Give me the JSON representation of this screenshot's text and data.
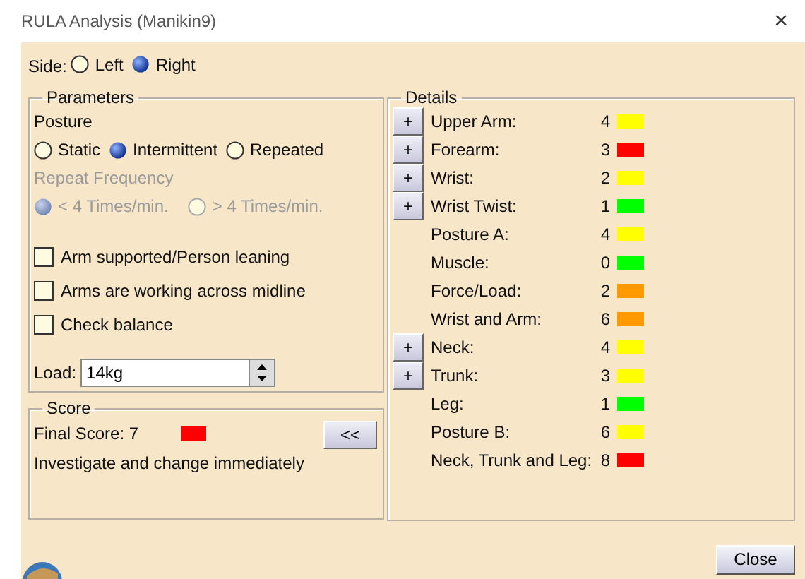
{
  "window": {
    "title": "RULA Analysis (Manikin9)",
    "close": "×"
  },
  "side": {
    "label": "Side:",
    "options": [
      {
        "label": "Left",
        "selected": false
      },
      {
        "label": "Right",
        "selected": true
      }
    ]
  },
  "parameters": {
    "title": "Parameters",
    "posture_label": "Posture",
    "posture_options": [
      {
        "label": "Static",
        "selected": false
      },
      {
        "label": "Intermittent",
        "selected": true
      },
      {
        "label": "Repeated",
        "selected": false
      }
    ],
    "repeat_frequency": {
      "label": "Repeat Frequency",
      "disabled": true,
      "options": [
        {
          "label": "< 4 Times/min.",
          "selected": true
        },
        {
          "label": "> 4 Times/min.",
          "selected": false
        }
      ]
    },
    "checkboxes": [
      {
        "label": "Arm supported/Person leaning",
        "checked": false
      },
      {
        "label": "Arms are working across midline",
        "checked": false
      },
      {
        "label": "Check balance",
        "checked": false
      }
    ],
    "load": {
      "label": "Load:",
      "value": "14kg"
    }
  },
  "score": {
    "title": "Score",
    "final_score": "Final Score: 7",
    "color": "#ff0000",
    "message": "Investigate and change immediately",
    "collapse_button": "<<"
  },
  "details": {
    "title": "Details",
    "rows": [
      {
        "kind": "expandable",
        "expand": "+",
        "label": "Upper Arm:",
        "value": "4",
        "color": "#ffff00"
      },
      {
        "kind": "expandable",
        "expand": "+",
        "label": "Forearm:",
        "value": "3",
        "color": "#ff0000"
      },
      {
        "kind": "expandable",
        "expand": "+",
        "label": "Wrist:",
        "value": "2",
        "color": "#ffff00"
      },
      {
        "kind": "expandable",
        "expand": "+",
        "label": "Wrist Twist:",
        "value": "1",
        "color": "#00ff00"
      },
      {
        "kind": "plain",
        "label": "Posture A:",
        "value": "4",
        "color": "#ffff00"
      },
      {
        "kind": "plain",
        "label": "Muscle:",
        "value": "0",
        "color": "#00ff00"
      },
      {
        "kind": "plain",
        "label": "Force/Load:",
        "value": "2",
        "color": "#ff9900"
      },
      {
        "kind": "plain",
        "label": "Wrist and Arm:",
        "value": "6",
        "color": "#ff9900"
      },
      {
        "kind": "expandable",
        "expand": "+",
        "label": "Neck:",
        "value": "4",
        "color": "#ffff00"
      },
      {
        "kind": "expandable",
        "expand": "+",
        "label": "Trunk:",
        "value": "3",
        "color": "#ffff00"
      },
      {
        "kind": "plain",
        "label": "Leg:",
        "value": "1",
        "color": "#00ff00"
      },
      {
        "kind": "plain",
        "label": "Posture B:",
        "value": "6",
        "color": "#ffff00"
      },
      {
        "kind": "plain",
        "label": "Neck, Trunk and Leg:",
        "value": "8",
        "color": "#ff0000"
      }
    ]
  },
  "buttons": [
    "Close"
  ]
}
